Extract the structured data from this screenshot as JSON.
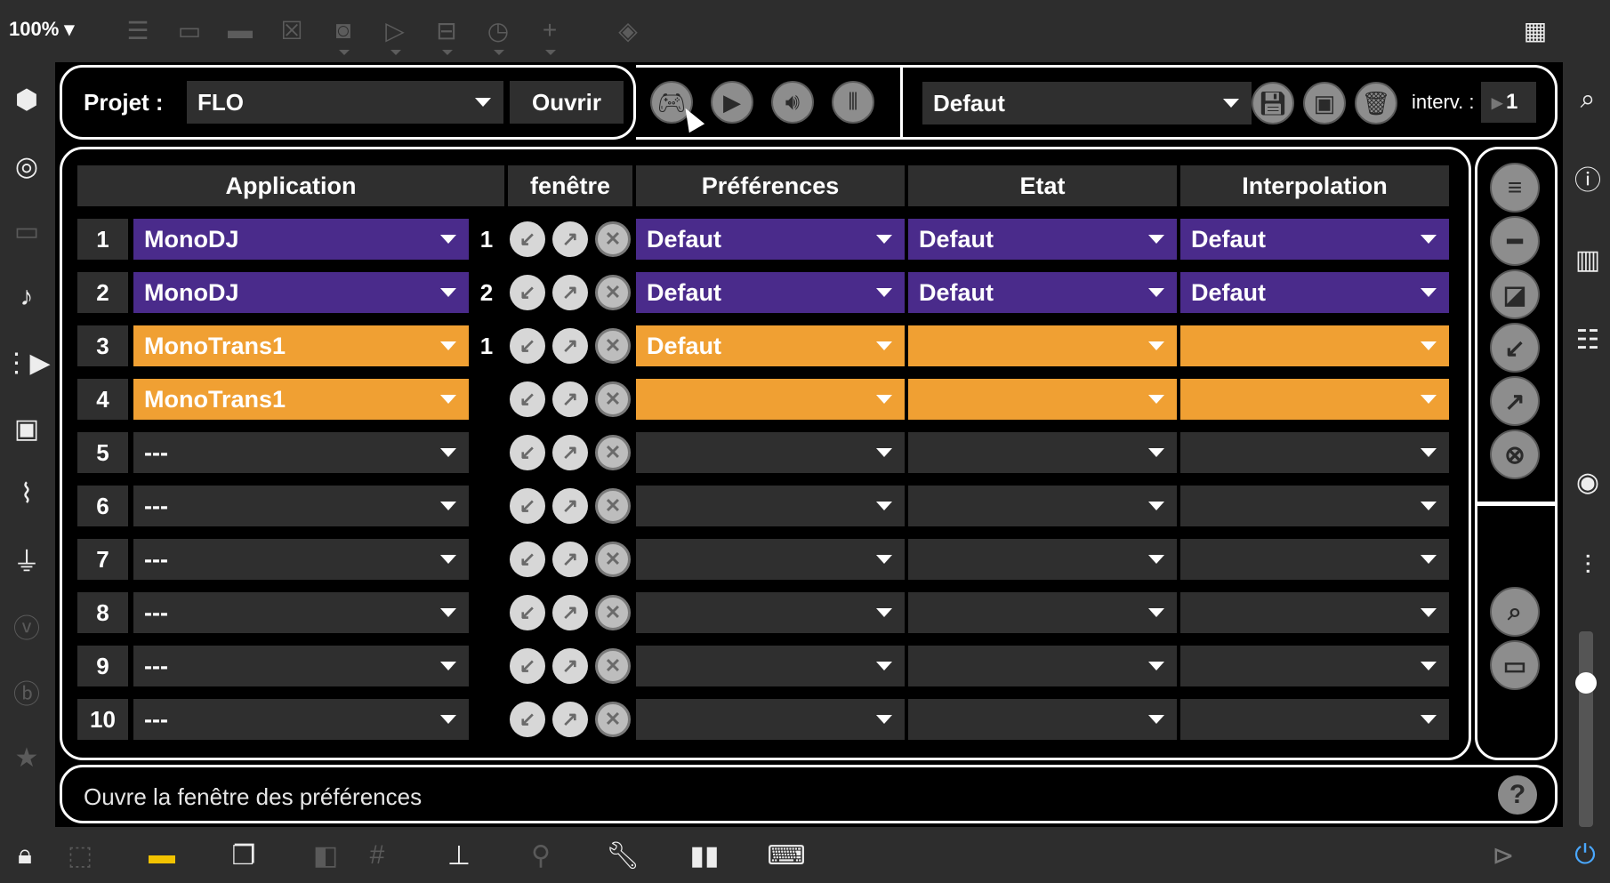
{
  "top": {
    "zoom": "100%"
  },
  "project": {
    "label": "Projet :",
    "value": "FLO",
    "open_button": "Ouvrir"
  },
  "preset": {
    "value": "Defaut",
    "interv_label": "interv. :",
    "interv_value": "1"
  },
  "table": {
    "headers": [
      "Application",
      "fenêtre",
      "Préférences",
      "Etat",
      "Interpolation"
    ],
    "rows": [
      {
        "num": "1",
        "app": "MonoDJ",
        "win": "1",
        "pref": "Defaut",
        "etat": "Defaut",
        "interp": "Defaut",
        "color": "purple"
      },
      {
        "num": "2",
        "app": "MonoDJ",
        "win": "2",
        "pref": "Defaut",
        "etat": "Defaut",
        "interp": "Defaut",
        "color": "purple"
      },
      {
        "num": "3",
        "app": "MonoTrans1",
        "win": "1",
        "pref": "Defaut",
        "etat": "",
        "interp": "",
        "color": "orange"
      },
      {
        "num": "4",
        "app": "MonoTrans1",
        "win": "",
        "pref": "",
        "etat": "",
        "interp": "",
        "color": "orange"
      },
      {
        "num": "5",
        "app": "---",
        "win": "",
        "pref": "",
        "etat": "",
        "interp": "",
        "color": "dark"
      },
      {
        "num": "6",
        "app": "---",
        "win": "",
        "pref": "",
        "etat": "",
        "interp": "",
        "color": "dark"
      },
      {
        "num": "7",
        "app": "---",
        "win": "",
        "pref": "",
        "etat": "",
        "interp": "",
        "color": "dark"
      },
      {
        "num": "8",
        "app": "---",
        "win": "",
        "pref": "",
        "etat": "",
        "interp": "",
        "color": "dark"
      },
      {
        "num": "9",
        "app": "---",
        "win": "",
        "pref": "",
        "etat": "",
        "interp": "",
        "color": "dark"
      },
      {
        "num": "10",
        "app": "---",
        "win": "",
        "pref": "",
        "etat": "",
        "interp": "",
        "color": "dark"
      }
    ]
  },
  "status": {
    "text": "Ouvre la fenêtre des préférences",
    "help": "?"
  },
  "colors": {
    "purple": "#4a2b8b",
    "orange": "#f0a033",
    "dark": "#2f2f2f"
  },
  "icons": {
    "controller": "gamepad-icon",
    "preview": "screen-settings-icon",
    "audio": "audio-settings-icon",
    "mixer": "mixer-sliders-icon"
  }
}
